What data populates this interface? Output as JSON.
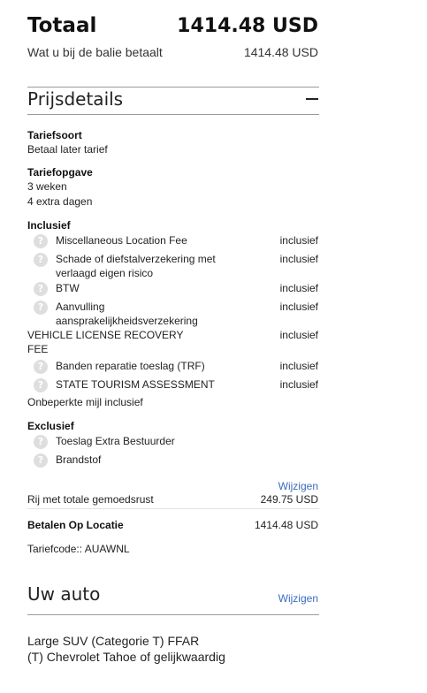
{
  "summary": {
    "total_label": "Totaal",
    "total_value": "1414.48 USD",
    "counter_label": "Wat u bij de balie betaalt",
    "counter_value": "1414.48 USD"
  },
  "price_details": {
    "title": "Prijsdetails",
    "rate_type_heading": "Tariefsoort",
    "rate_type_value": "Betaal later tarief",
    "rate_spec_heading": "Tariefopgave",
    "rate_spec_lines": [
      "3 weken",
      "4 extra dagen"
    ],
    "included_heading": "Inclusief",
    "included_items": [
      {
        "label": "Miscellaneous Location Fee",
        "value": "inclusief"
      },
      {
        "label_line1": "Schade of diefstalverzekering met",
        "label_line2": "verlaagd eigen risico",
        "value": "inclusief"
      },
      {
        "label": "BTW",
        "value": "inclusief"
      },
      {
        "label_line1": "Aanvulling",
        "label_line2": "aansprakelijkheidsverzekering",
        "value": "inclusief"
      },
      {
        "label_line1": "VEHICLE LICENSE RECOVERY",
        "label_line2": "FEE",
        "value": "inclusief"
      },
      {
        "label": "Banden reparatie toeslag (TRF)",
        "value": "inclusief"
      },
      {
        "label": "STATE TOURISM ASSESSMENT",
        "value": "inclusief"
      }
    ],
    "unlimited_miles": "Onbeperkte mijl inclusief",
    "excluded_heading": "Exclusief",
    "excluded_items": [
      "Toeslag Extra Bestuurder",
      "Brandstof"
    ],
    "change_link": "Wijzigen",
    "peace_label": "Rij met totale gemoedsrust",
    "peace_value": "249.75 USD",
    "pay_location_label": "Betalen Op Locatie",
    "pay_location_value": "1414.48 USD",
    "rate_code": "Tariefcode:: AUAWNL"
  },
  "car": {
    "title": "Uw auto",
    "change_link": "Wijzigen",
    "line1": "Large SUV (Categorie T) FFAR",
    "line2": "(T) Chevrolet Tahoe of gelijkwaardig"
  },
  "icons": {
    "help": "question-mark-icon",
    "collapse": "minus-icon"
  }
}
